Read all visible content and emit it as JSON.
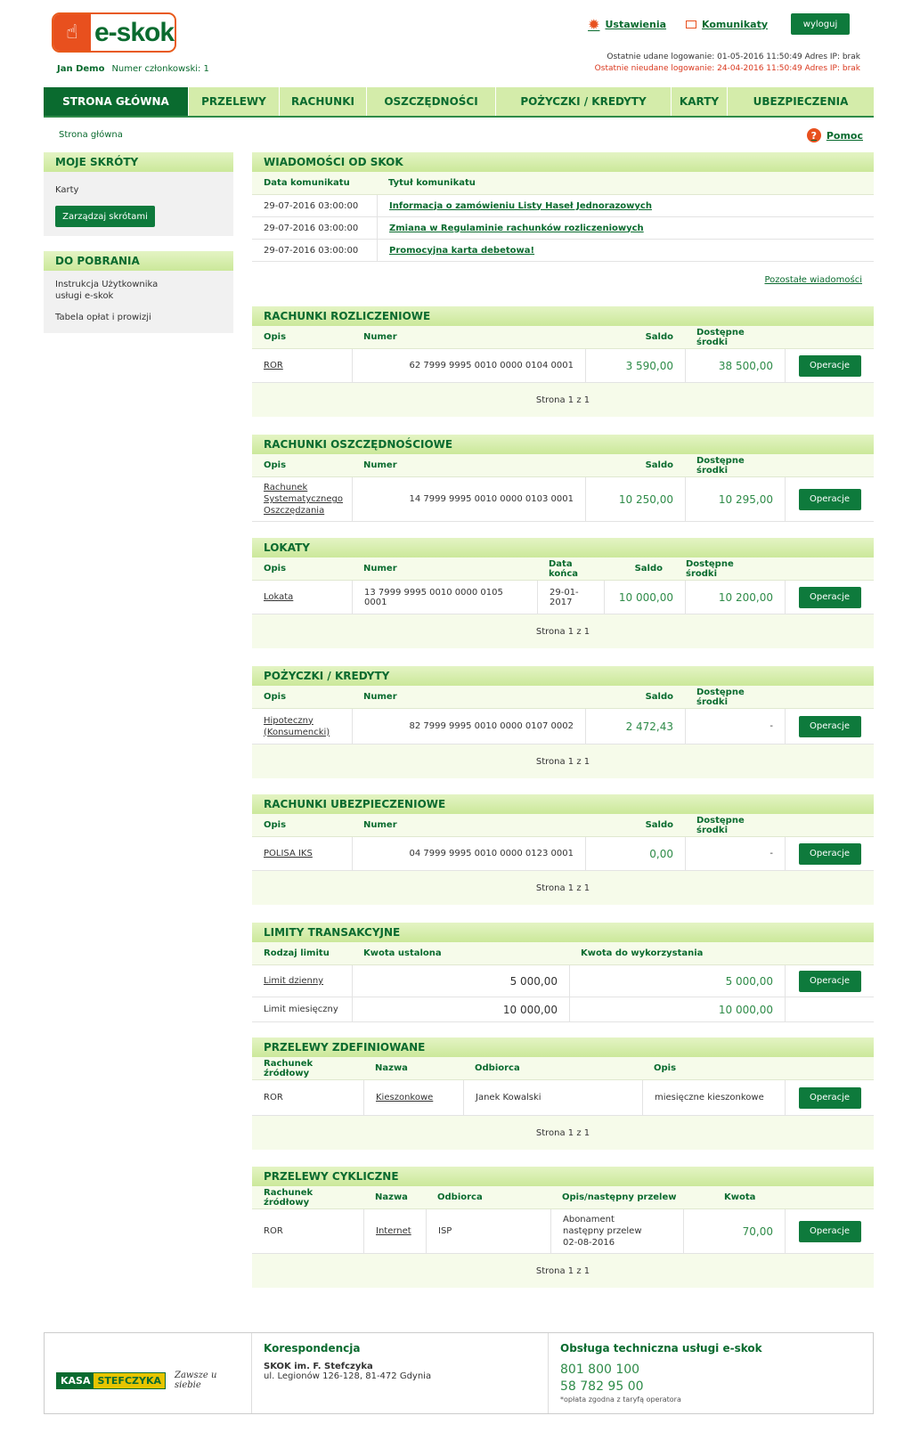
{
  "header": {
    "logo": "e-skok",
    "user_name": "Jan Demo",
    "member": "Numer członkowski: 1",
    "settings": "Ustawienia",
    "messages": "Komunikaty",
    "logout": "wyloguj",
    "last_ok": "Ostatnie udane logowanie: 01-05-2016 11:50:49 Adres IP: brak",
    "last_fail": "Ostatnie nieudane logowanie: 24-04-2016 11:50:49 Adres IP: brak"
  },
  "menu": [
    "STRONA GŁÓWNA",
    "PRZELEWY",
    "RACHUNKI",
    "OSZCZĘDNOŚCI",
    "POŻYCZKI / KREDYTY",
    "KARTY",
    "UBEZPIECZENIA"
  ],
  "breadcrumb": "Strona główna",
  "help": "Pomoc",
  "shortcuts": {
    "title": "MOJE SKRÓTY",
    "item": "Karty",
    "manage": "Zarządzaj skrótami"
  },
  "downloads": {
    "title": "DO POBRANIA",
    "items": [
      "Instrukcja Użytkownika usługi e-skok",
      "Tabela opłat i prowizji"
    ]
  },
  "news": {
    "title": "WIADOMOŚCI OD SKOK",
    "col1": "Data komunikatu",
    "col2": "Tytuł komunikatu",
    "rows": [
      [
        "29-07-2016 03:00:00",
        "Informacja o zamówieniu Listy Haseł Jednorazowych"
      ],
      [
        "29-07-2016 03:00:00",
        "Zmiana w Regulaminie rachunków rozliczeniowych"
      ],
      [
        "29-07-2016 03:00:00",
        "Promocyjna karta debetowa!"
      ]
    ],
    "more": "Pozostałe wiadomości"
  },
  "common": {
    "opis": "Opis",
    "numer": "Numer",
    "saldo": "Saldo",
    "dostepne": "Dostępne środki",
    "operacje": "Operacje",
    "pager": "Strona 1 z 1"
  },
  "ror": {
    "title": "RACHUNKI ROZLICZENIOWE",
    "opis": "ROR",
    "numer": "62 7999 9995 0010 0000 0104 0001",
    "saldo": "3 590,00",
    "dostepne": "38 500,00"
  },
  "savings": {
    "title": "RACHUNKI OSZCZĘDNOŚCIOWE",
    "opis": "Rachunek Systematycznego Oszczędzania",
    "numer": "14 7999 9995 0010 0000 0103 0001",
    "saldo": "10 250,00",
    "dostepne": "10 295,00"
  },
  "deposits": {
    "title": "LOKATY",
    "col_end": "Data końca",
    "opis": "Lokata",
    "numer": "13 7999 9995 0010 0000 0105 0001",
    "data": "29-01-2017",
    "saldo": "10 000,00",
    "dostepne": "10 200,00"
  },
  "loans": {
    "title": "POŻYCZKI / KREDYTY",
    "opis": "Hipoteczny (Konsumencki)",
    "numer": "82 7999 9995 0010 0000 0107 0002",
    "saldo": "2 472,43",
    "dostepne": "-"
  },
  "insurance": {
    "title": "RACHUNKI UBEZPIECZENIOWE",
    "opis": "POLISA IKS",
    "numer": "04 7999 9995 0010 0000 0123 0001",
    "saldo": "0,00",
    "dostepne": "-"
  },
  "limits": {
    "title": "LIMITY TRANSAKCYJNE",
    "col1": "Rodzaj limitu",
    "col2": "Kwota ustalona",
    "col3": "Kwota do wykorzystania",
    "rows": [
      [
        "Limit dzienny",
        "5 000,00",
        "5 000,00"
      ],
      [
        "Limit miesięczny",
        "10 000,00",
        "10 000,00"
      ]
    ]
  },
  "defined": {
    "title": "PRZELEWY ZDEFINIOWANE",
    "col1": "Rachunek źródłowy",
    "col2": "Nazwa",
    "col3": "Odbiorca",
    "col4": "Opis",
    "src": "ROR",
    "name": "Kieszonkowe",
    "recv": "Janek Kowalski",
    "desc": "miesięczne kieszonkowe"
  },
  "cyclic": {
    "title": "PRZELEWY CYKLICZNE",
    "col1": "Rachunek źródłowy",
    "col2": "Nazwa",
    "col3": "Odbiorca",
    "col4": "Opis/następny przelew",
    "col5": "Kwota",
    "src": "ROR",
    "name": "Internet",
    "recv": "ISP",
    "desc1": "Abonament",
    "desc2": "następny przelew",
    "desc3": "02-08-2016",
    "amount": "70,00"
  },
  "footer": {
    "brand1": "KASA",
    "brand2": "STEFCZYKA",
    "slogan": "Zawsze u siebie",
    "corr": "Korespondencja",
    "org": "SKOK im. F. Stefczyka",
    "addr": "ul. Legionów 126-128, 81-472 Gdynia",
    "support": "Obsługa techniczna usługi e-skok",
    "ph1": "801 800 100",
    "ph2": "58 782 95 00",
    "note": "*opłata zgodna z taryfą operatora"
  }
}
